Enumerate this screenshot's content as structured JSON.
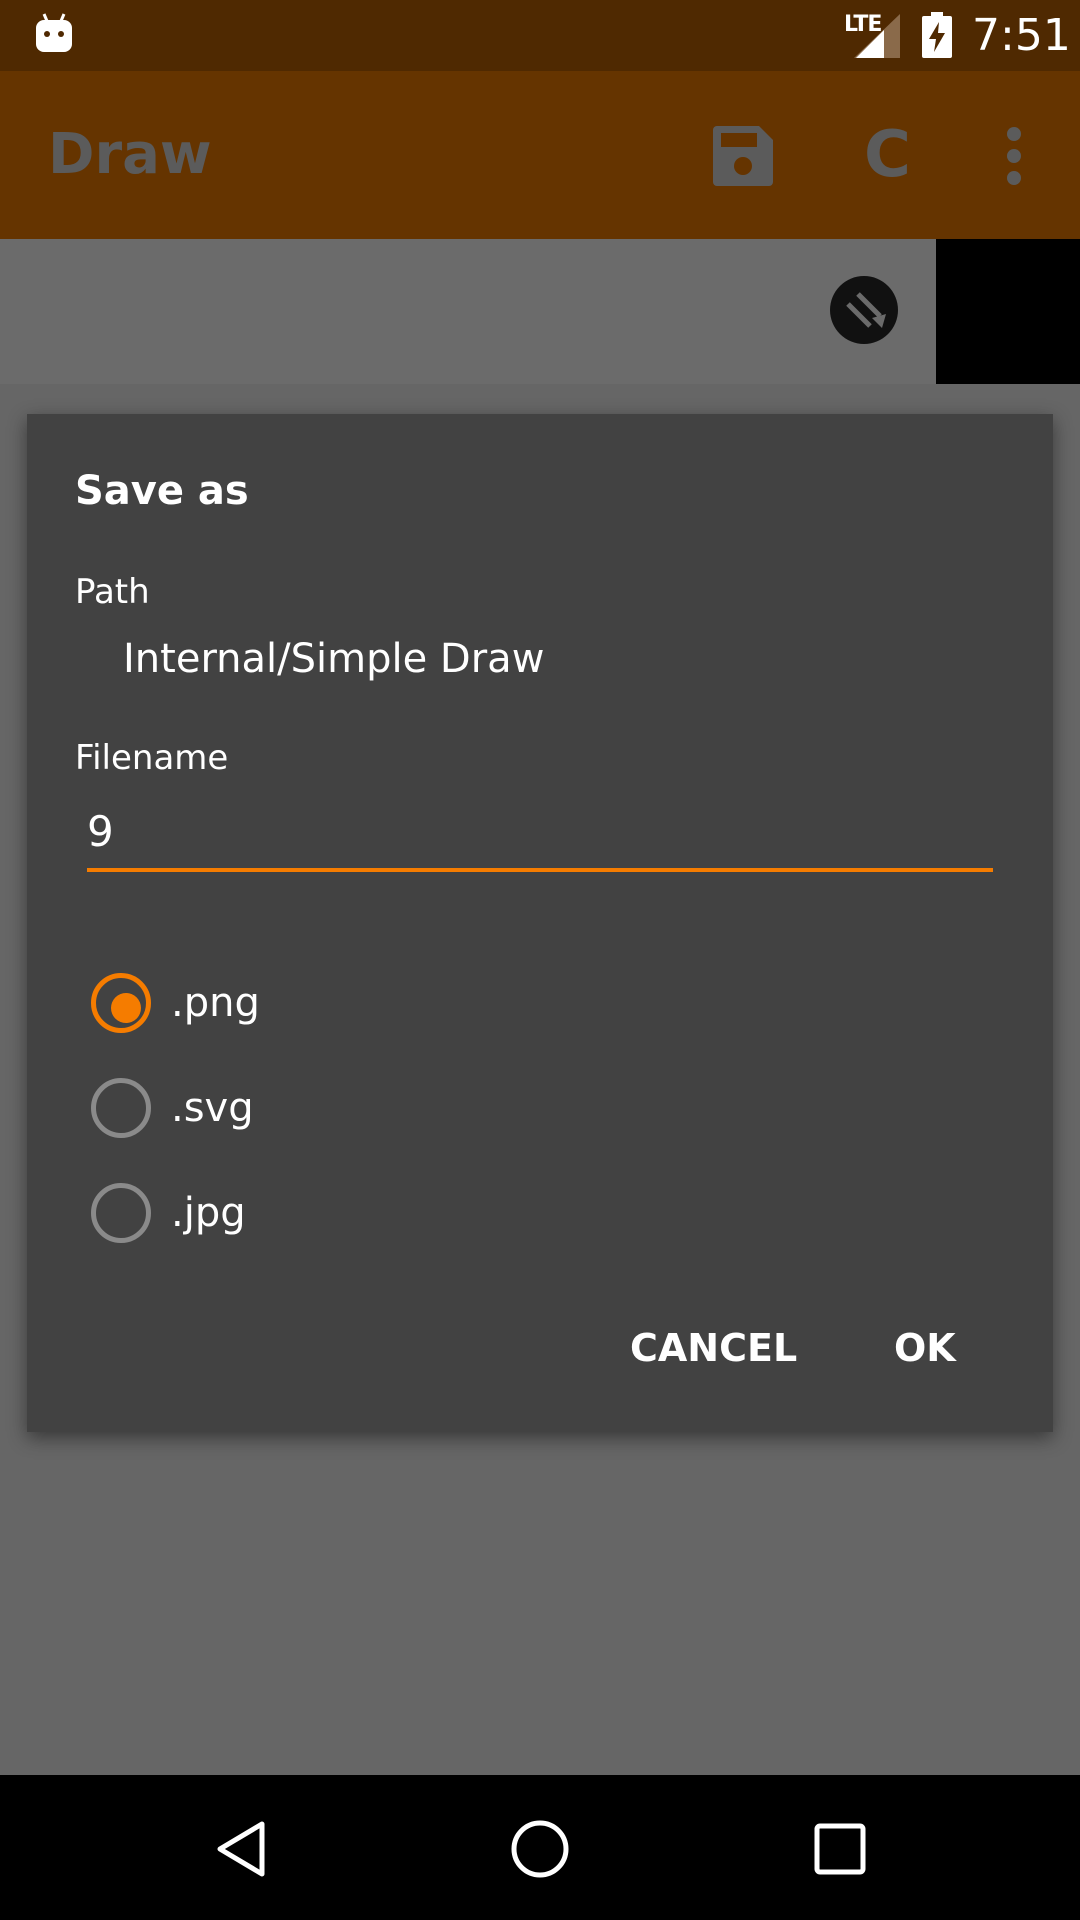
{
  "status_bar": {
    "network": "LTE",
    "time": "7:51",
    "icons": [
      "android-app-icon",
      "signal-icon",
      "battery-charging-icon"
    ]
  },
  "toolbar": {
    "title": "Draw",
    "save_icon": "save-icon",
    "clear_label": "C",
    "overflow_icon": "more-vert-icon"
  },
  "canvas": {
    "tool_icon": "eraser-icon",
    "swatch_color": "#000000"
  },
  "dialog": {
    "title": "Save as",
    "path_label": "Path",
    "path_value": "Internal/Simple Draw",
    "filename_label": "Filename",
    "filename_value": "9",
    "formats": [
      {
        "label": ".png",
        "checked": true
      },
      {
        "label": ".svg",
        "checked": false
      },
      {
        "label": ".jpg",
        "checked": false
      }
    ],
    "cancel_label": "CANCEL",
    "ok_label": "OK",
    "accent_color": "#f57c00"
  },
  "nav_bar": {
    "icons": [
      "back-icon",
      "home-icon",
      "recents-icon"
    ]
  }
}
